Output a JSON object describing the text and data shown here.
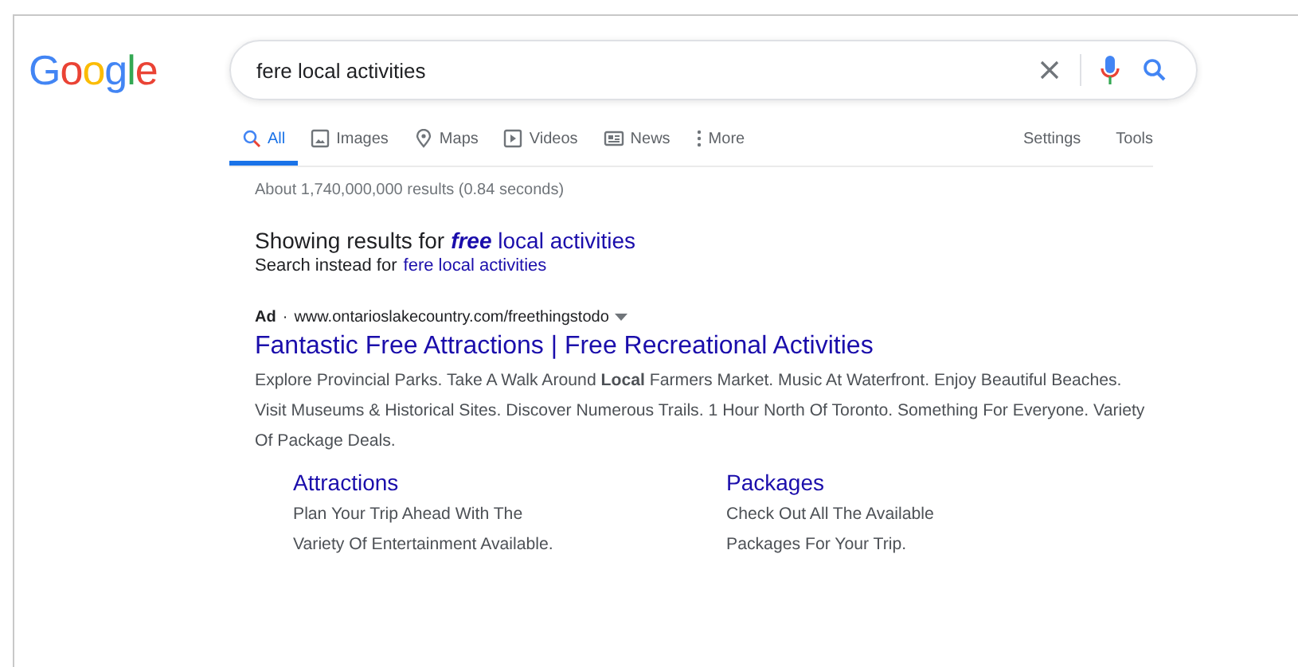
{
  "logo": "Google",
  "search": {
    "value": "fere local activities"
  },
  "tabs": [
    {
      "label": "All",
      "selected": true
    },
    {
      "label": "Images",
      "selected": false
    },
    {
      "label": "Maps",
      "selected": false
    },
    {
      "label": "Videos",
      "selected": false
    },
    {
      "label": "News",
      "selected": false
    },
    {
      "label": "More",
      "selected": false
    }
  ],
  "tools": [
    "Settings",
    "Tools"
  ],
  "result_stats": "About 1,740,000,000 results (0.84 seconds)",
  "spelling": {
    "showing_prefix": "Showing results for",
    "showing_link": "**free** local activities",
    "instead_prefix": "Search instead for",
    "instead_link": "fere local activities"
  },
  "ad": {
    "label": "Ad",
    "separator": "·",
    "url": "www.ontarioslakecountry.com/freethingstodo",
    "title": "Fantastic Free Attractions | Free Recreational Activities",
    "description": "Explore Provincial Parks. Take A Walk Around **Local** Farmers Market. Music At Waterfront. Enjoy Beautiful Beaches. Visit Museums & Historical Sites. Discover Numerous Trails. 1 Hour North Of Toronto. Something For Everyone. Variety Of Package Deals.",
    "sitelinks": [
      {
        "title": "Attractions",
        "lines": [
          "Plan Your Trip Ahead With The",
          "Variety Of Entertainment Available."
        ]
      },
      {
        "title": "Packages",
        "lines": [
          "Check Out All The Available",
          "Packages For Your Trip."
        ]
      }
    ]
  }
}
